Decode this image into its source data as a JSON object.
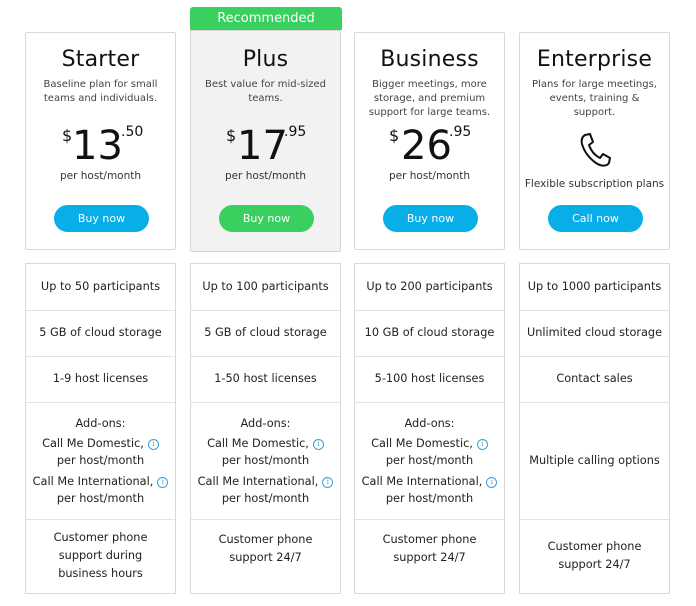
{
  "badge": "Recommended",
  "plans": [
    {
      "name": "Starter",
      "desc": "Baseline plan for small teams and individuals.",
      "currency": "$",
      "price_int": "13",
      "price_dec": ".50",
      "per": "per host/month",
      "button": "Buy now"
    },
    {
      "name": "Plus",
      "desc": "Best value for mid-sized teams.",
      "currency": "$",
      "price_int": "17",
      "price_dec": ".95",
      "per": "per host/month",
      "button": "Buy now"
    },
    {
      "name": "Business",
      "desc": "Bigger meetings, more storage, and premium support for large teams.",
      "currency": "$",
      "price_int": "26",
      "price_dec": ".95",
      "per": "per host/month",
      "button": "Buy now"
    },
    {
      "name": "Enterprise",
      "desc": "Plans for large meetings, events, training & support.",
      "icon": "phone-icon",
      "flexible": "Flexible subscription plans",
      "button": "Call now"
    }
  ],
  "features": [
    {
      "participants": "Up to 50 participants",
      "storage": "5 GB of cloud storage",
      "licenses": "1-9 host licenses",
      "addons_title": "Add-ons:",
      "addon1": "Call Me Domestic,",
      "addon1b": "per host/month",
      "addon2": "Call Me International,",
      "addon2b": "per host/month",
      "support": "Customer phone support during business hours"
    },
    {
      "participants": "Up to 100 participants",
      "storage": "5 GB of cloud storage",
      "licenses": "1-50 host licenses",
      "addons_title": "Add-ons:",
      "addon1": "Call Me Domestic,",
      "addon1b": "per host/month",
      "addon2": "Call Me International,",
      "addon2b": "per host/month",
      "support": "Customer phone support 24/7"
    },
    {
      "participants": "Up to 200 participants",
      "storage": "10 GB of cloud storage",
      "licenses": "5-100 host licenses",
      "addons_title": "Add-ons:",
      "addon1": "Call Me Domestic,",
      "addon1b": "per host/month",
      "addon2": "Call Me International,",
      "addon2b": "per host/month",
      "support": "Customer phone support 24/7"
    },
    {
      "participants": "Up to 1000 participants",
      "storage": "Unlimited cloud storage",
      "licenses": "Contact sales",
      "addons": "Multiple calling options",
      "support": "Customer phone support 24/7"
    }
  ],
  "info_symbol": "i",
  "colors": {
    "accent_blue": "#07aee8",
    "accent_green": "#3ad05f",
    "info_blue": "#3aa0d8"
  }
}
